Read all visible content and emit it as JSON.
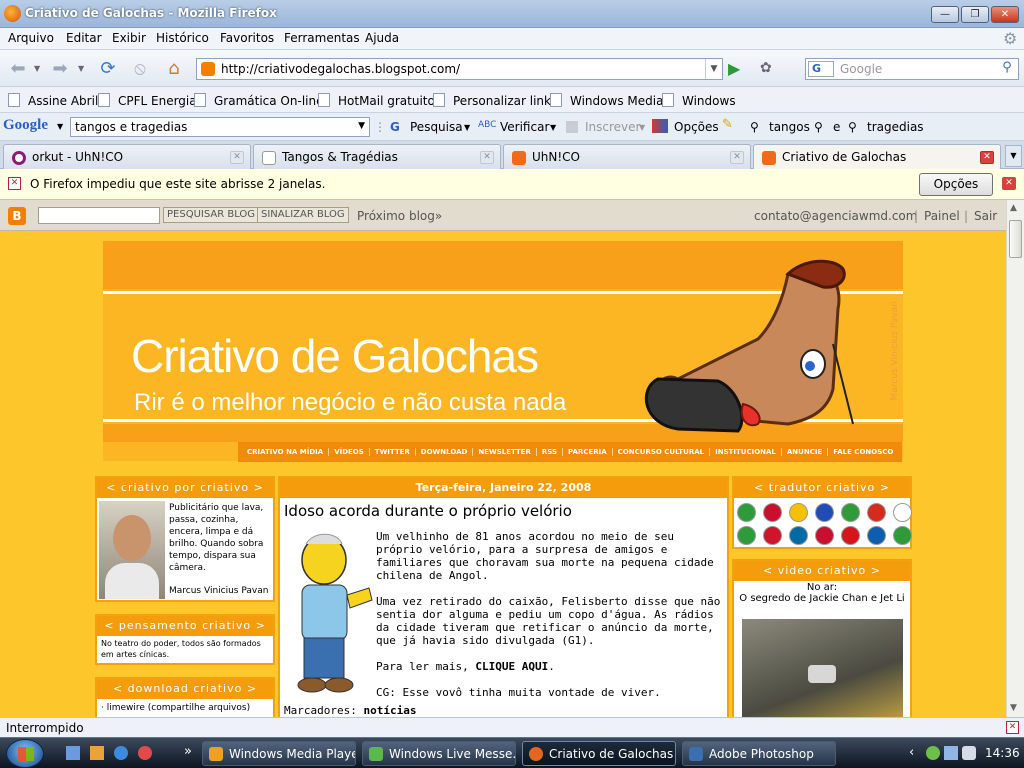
{
  "window": {
    "title": "Criativo de Galochas - Mozilla Firefox",
    "min_icon": "minimize-icon",
    "max_icon": "maximize-icon",
    "close_icon": "close-icon"
  },
  "menu": [
    "Arquivo",
    "Editar",
    "Exibir",
    "Histórico",
    "Favoritos",
    "Ferramentas",
    "Ajuda"
  ],
  "nav": {
    "url": "http://criativodegalochas.blogspot.com/",
    "search_engine": "G",
    "search_placeholder": "Google"
  },
  "bookmarks": [
    "Assine Abril",
    "CPFL Energia",
    "Gramática On-line",
    "HotMail gratuito",
    "Personalizar links",
    "Windows Media",
    "Windows"
  ],
  "google_toolbar": {
    "logo": "Google",
    "query": "tangos e tragedias",
    "pesquisa": "Pesquisa",
    "verificar": "Verificar",
    "inscrever": "Inscrever",
    "opcoes": "Opções",
    "term1": "tangos",
    "conj": "e",
    "term2": "tragedias"
  },
  "tabs": [
    {
      "label": "orkut - UhN!CO",
      "color": "#8a1b7b"
    },
    {
      "label": "Tangos & Tragédias",
      "color": "#ffffff"
    },
    {
      "label": "UhN!CO",
      "color": "#f06a1a"
    },
    {
      "label": "Criativo de Galochas",
      "color": "#f06a1a"
    }
  ],
  "notification": {
    "text": "O Firefox impediu que este site abrisse 2 janelas.",
    "button": "Opções"
  },
  "blogger_bar": {
    "search_button": "PESQUISAR BLOG",
    "flag_button": "SINALIZAR BLOG",
    "next_blog": "Próximo blog»",
    "email": "contato@agenciawmd.com",
    "sep": "|",
    "panel": "Painel",
    "logout": "Sair"
  },
  "header": {
    "title": "Criativo de Galochas",
    "subtitle": "Rir é o melhor negócio e não custa nada",
    "credit": "Marcus Vinicius Pavan",
    "links": [
      "CRIATIVO NA MÍDIA",
      "VÍDEOS",
      "TWITTER",
      "DOWNLOAD",
      "NEWSLETTER",
      "RSS",
      "PARCERIA",
      "CONCURSO CULTURAL",
      "INSTITUCIONAL",
      "ANUNCIE",
      "FALE CONOSCO"
    ]
  },
  "left": {
    "profile_title": "< criativo por criativo >",
    "profile_text": "Publicitário que lava, passa, cozinha, encera, limpa e dá brilho. Quando sobra tempo, dispara sua câmera.",
    "profile_name": "Marcus Vinicius Pavan",
    "pensamento_title": "< pensamento criativo >",
    "pensamento_text": "No teatro do poder, todos são formados em artes cínicas.",
    "download_title": "< download criativo >",
    "download_item": "· limewire (compartilhe arquivos)"
  },
  "post": {
    "date": "Terça-feira, Janeiro 22, 2008",
    "title": "Idoso acorda durante o próprio velório",
    "p1": "Um velhinho de 81 anos acordou no meio de seu próprio velório, para a surpresa de amigos e familiares que choravam sua morte na pequena cidade chilena de Angol.",
    "p2": "Uma vez retirado do caixão, Felisberto disse que não sentia dor alguma e pediu um copo d'água. As rádios da cidade tiveram que retificar o anúncio da morte, que já havia sido divulgada (G1).",
    "p3_prefix": "Para ler mais,",
    "p3_link": "CLIQUE AQUI",
    "p3_suffix": ".",
    "p4": "CG: Esse vovô tinha muita vontade de viver.",
    "labels_prefix": "Marcadores:",
    "labels_value": "notícias"
  },
  "right": {
    "tradutor_title": "< tradutor criativo >",
    "flags": [
      "#2e9b3a",
      "#c8102e",
      "#f6c000",
      "#1f4db5",
      "#2e9b3a",
      "#d52b1e",
      "#ffffff",
      "#2e9b3a",
      "#cf142b",
      "#006aa7",
      "#c8102e",
      "#d7141a",
      "#0d5eaf",
      "#2e9b3a"
    ],
    "video_title": "< video criativo >",
    "video_on_air": "No ar:",
    "video_name": "O segredo de Jackie Chan e Jet Li"
  },
  "status": {
    "text": "Interrompido"
  },
  "taskbar": {
    "chevron": "»",
    "tasks": [
      "Windows Media Player",
      "Windows Live Messe...",
      "Criativo de Galochas ...",
      "Adobe Photoshop"
    ],
    "tray_chevron": "‹",
    "clock": "14:36"
  }
}
